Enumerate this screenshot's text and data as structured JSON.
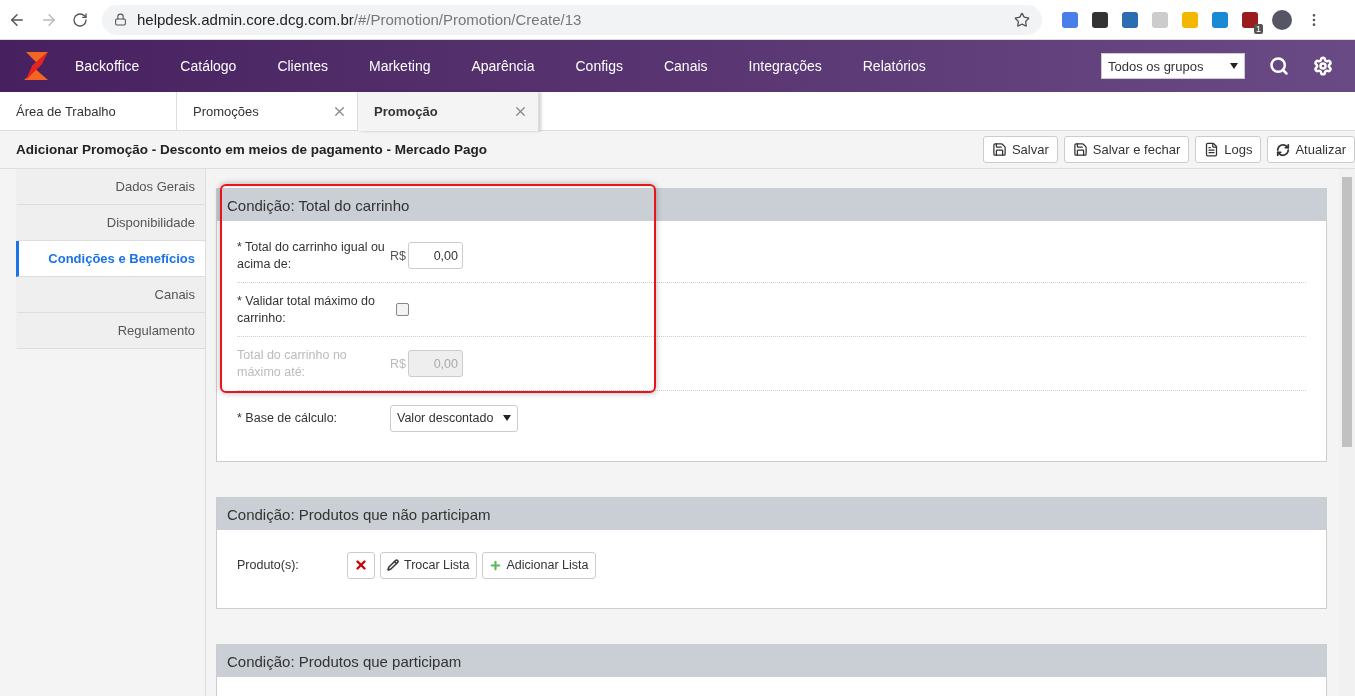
{
  "browser": {
    "url_host": "helpdesk.admin.core.dcg.com.br",
    "url_path": "/#/Promotion/Promotion/Create/13",
    "extension_badge": "1"
  },
  "nav": {
    "items": [
      "Backoffice",
      "Catálogo",
      "Clientes",
      "Marketing",
      "Aparência",
      "Configs",
      "Canais",
      "Integrações",
      "Relatórios"
    ],
    "group_select": "Todos os grupos"
  },
  "tabs": [
    {
      "label": "Área de Trabalho",
      "selected": false,
      "closable": false
    },
    {
      "label": "Promoções",
      "selected": false,
      "closable": true
    },
    {
      "label": "Promoção",
      "selected": true,
      "closable": true
    }
  ],
  "page_title": "Adicionar Promoção - Desconto em meios de pagamento - Mercado Pago",
  "toolbar": [
    {
      "label": "Salvar",
      "kind": "save"
    },
    {
      "label": "Salvar e fechar",
      "kind": "save"
    },
    {
      "label": "Logs",
      "kind": "logs"
    },
    {
      "label": "Atualizar",
      "kind": "refresh"
    }
  ],
  "sidebar": {
    "items": [
      {
        "label": "Dados Gerais",
        "selected": false
      },
      {
        "label": "Disponibilidade",
        "selected": false
      },
      {
        "label": "Condições e Benefícios",
        "selected": true
      },
      {
        "label": "Canais",
        "selected": false
      },
      {
        "label": "Regulamento",
        "selected": false
      }
    ]
  },
  "sections": [
    {
      "title": "Condição: Total do carrinho",
      "highlighted": true,
      "rows": [
        {
          "kind": "money",
          "label": "* Total do carrinho igual ou acima de:",
          "currency": "R$",
          "value": "0,00",
          "disabled": false
        },
        {
          "kind": "checkbox",
          "label": "* Validar total máximo do carrinho:",
          "checked": false
        },
        {
          "kind": "money",
          "label": "Total do carrinho no máximo até:",
          "currency": "R$",
          "value": "0,00",
          "disabled": true
        },
        {
          "kind": "select",
          "label": "* Base de cálculo:",
          "value": "Valor descontado"
        }
      ]
    },
    {
      "title": "Condição: Produtos que não participam",
      "highlighted": false,
      "rows": [
        {
          "kind": "products",
          "label": "Produto(s):",
          "buttons": [
            {
              "kind": "remove"
            },
            {
              "kind": "edit",
              "label": "Trocar Lista"
            },
            {
              "kind": "add",
              "label": "Adicionar Lista"
            }
          ]
        }
      ]
    },
    {
      "title": "Condição: Produtos que participam",
      "highlighted": false
    }
  ]
}
